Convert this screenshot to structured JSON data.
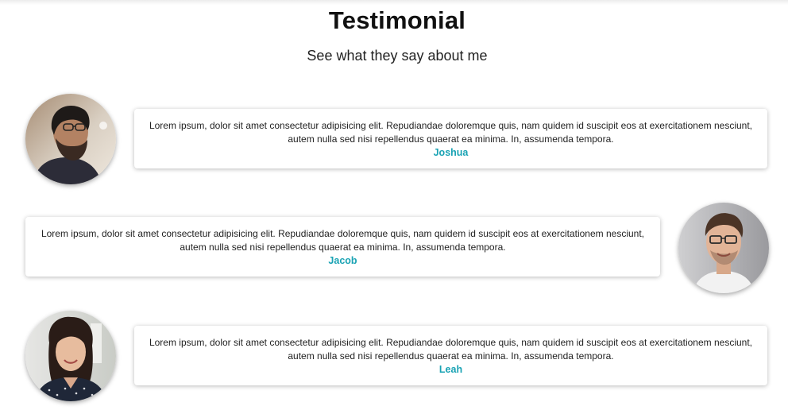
{
  "page": {
    "title": "Testimonial",
    "subtitle": "See what they say about me"
  },
  "testimonials": [
    {
      "text": "Lorem ipsum, dolor sit amet consectetur adipisicing elit. Repudiandae doloremque quis, nam quidem id suscipit eos at exercitationem nesciunt, autem nulla sed nisi repellendus quaerat ea minima. In, assumenda tempora.",
      "name": "Joshua",
      "photo_side": "left"
    },
    {
      "text": "Lorem ipsum, dolor sit amet consectetur adipisicing elit. Repudiandae doloremque quis, nam quidem id suscipit eos at exercitationem nesciunt, autem nulla sed nisi repellendus quaerat ea minima. In, assumenda tempora.",
      "name": "Jacob",
      "photo_side": "right"
    },
    {
      "text": "Lorem ipsum, dolor sit amet consectetur adipisicing elit. Repudiandae doloremque quis, nam quidem id suscipit eos at exercitationem nesciunt, autem nulla sed nisi repellendus quaerat ea minima. In, assumenda tempora.",
      "name": "Leah",
      "photo_side": "left"
    }
  ],
  "colors": {
    "name_accent": "#1aa3b4",
    "card_background": "#ffffff",
    "page_background": "#ffffff"
  }
}
